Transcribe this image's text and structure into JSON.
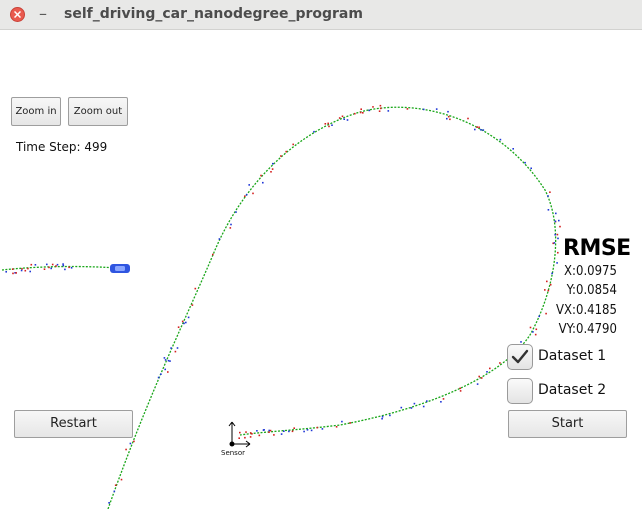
{
  "window": {
    "title": "self_driving_car_nanodegree_program",
    "minimize_glyph": "–",
    "close_icon": "close-icon"
  },
  "toolbar": {
    "zoom_in_label": "Zoom in",
    "zoom_out_label": "Zoom out"
  },
  "status": {
    "time_step_text": "Time Step: 499"
  },
  "rmse": {
    "title": "RMSE",
    "rows": [
      {
        "label": "X:",
        "value": "0.0975"
      },
      {
        "label": "Y:",
        "value": "0.0854"
      },
      {
        "label": "VX:",
        "value": "0.4185"
      },
      {
        "label": "VY:",
        "value": "0.4790"
      }
    ]
  },
  "datasets": [
    {
      "label": "Dataset 1",
      "checked": true
    },
    {
      "label": "Dataset 2",
      "checked": false
    }
  ],
  "controls": {
    "restart_label": "Restart",
    "start_label": "Start"
  },
  "sensor": {
    "label": "Sensor"
  },
  "colors": {
    "estimate_path": "#19a619",
    "lidar_markers": "#d42020",
    "radar_markers": "#1f36d6",
    "car": "#2f55e0",
    "close_button": "#e95a4f",
    "titlebar": "#e8e8e7"
  }
}
